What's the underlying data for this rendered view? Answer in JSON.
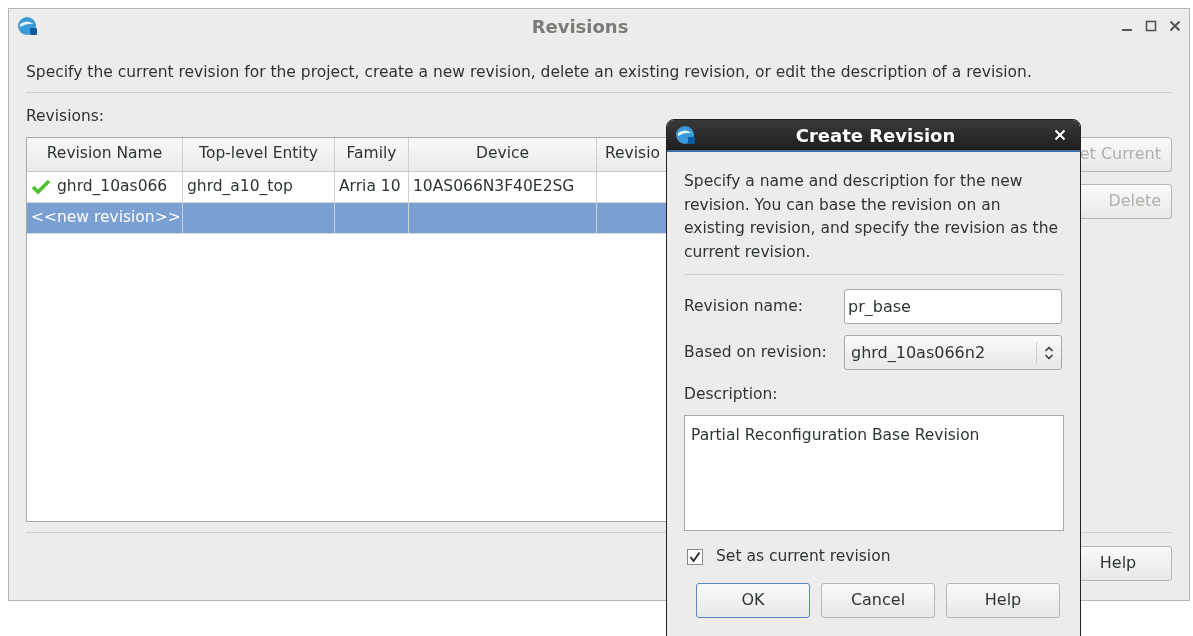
{
  "window": {
    "title": "Revisions",
    "intro": "Specify the current revision for the project, create a new revision, delete an existing revision, or edit the description of a revision.",
    "revisions_label": "Revisions:"
  },
  "table": {
    "columns": [
      "Revision Name",
      "Top-level Entity",
      "Family",
      "Device",
      "Revisio"
    ],
    "rows": [
      {
        "selected": false,
        "current": true,
        "cells": [
          "ghrd_10as066",
          "ghrd_a10_top",
          "Arria 10",
          "10AS066N3F40E2SG"
        ]
      },
      {
        "selected": true,
        "current": false,
        "cells": [
          "<<new revision>>"
        ]
      }
    ]
  },
  "side_buttons": [
    {
      "label": "et Current",
      "disabled": true
    },
    {
      "label": "Delete",
      "disabled": true
    }
  ],
  "help_button": {
    "label": "Help"
  },
  "dialog": {
    "title": "Create Revision",
    "intro": "Specify a name and description for the new revision. You can base the revision on an existing revision, and specify the revision as the current revision.",
    "fields": [
      {
        "kind": "text",
        "label": "Revision name:",
        "value": "pr_base"
      },
      {
        "kind": "select",
        "label": "Based on revision:",
        "value": "ghrd_10as066n2"
      }
    ],
    "description_label": "Description:",
    "description": "Partial Reconfiguration Base Revision",
    "checkbox": {
      "label": "Set as current revision",
      "checked": true
    },
    "buttons": [
      {
        "label": "OK",
        "default": true
      },
      {
        "label": "Cancel",
        "default": false
      },
      {
        "label": "Help",
        "default": false
      }
    ]
  }
}
